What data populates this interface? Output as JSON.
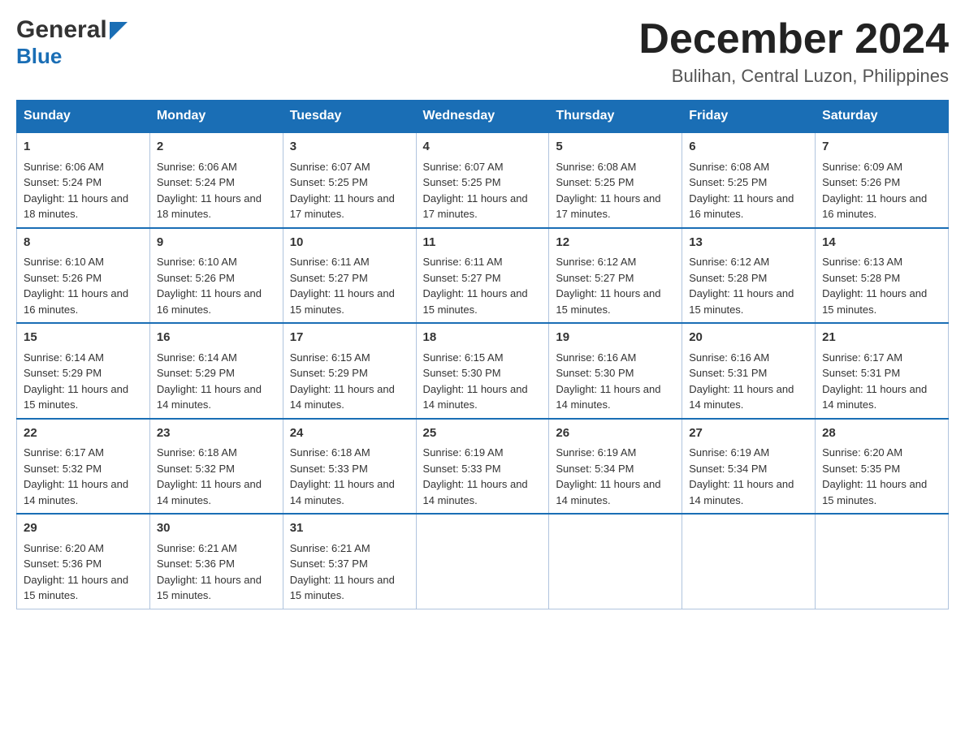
{
  "header": {
    "month_title": "December 2024",
    "location": "Bulihan, Central Luzon, Philippines",
    "logo_general": "General",
    "logo_blue": "Blue"
  },
  "days_of_week": [
    "Sunday",
    "Monday",
    "Tuesday",
    "Wednesday",
    "Thursday",
    "Friday",
    "Saturday"
  ],
  "weeks": [
    [
      {
        "day": "1",
        "sunrise": "6:06 AM",
        "sunset": "5:24 PM",
        "daylight": "11 hours and 18 minutes."
      },
      {
        "day": "2",
        "sunrise": "6:06 AM",
        "sunset": "5:24 PM",
        "daylight": "11 hours and 18 minutes."
      },
      {
        "day": "3",
        "sunrise": "6:07 AM",
        "sunset": "5:25 PM",
        "daylight": "11 hours and 17 minutes."
      },
      {
        "day": "4",
        "sunrise": "6:07 AM",
        "sunset": "5:25 PM",
        "daylight": "11 hours and 17 minutes."
      },
      {
        "day": "5",
        "sunrise": "6:08 AM",
        "sunset": "5:25 PM",
        "daylight": "11 hours and 17 minutes."
      },
      {
        "day": "6",
        "sunrise": "6:08 AM",
        "sunset": "5:25 PM",
        "daylight": "11 hours and 16 minutes."
      },
      {
        "day": "7",
        "sunrise": "6:09 AM",
        "sunset": "5:26 PM",
        "daylight": "11 hours and 16 minutes."
      }
    ],
    [
      {
        "day": "8",
        "sunrise": "6:10 AM",
        "sunset": "5:26 PM",
        "daylight": "11 hours and 16 minutes."
      },
      {
        "day": "9",
        "sunrise": "6:10 AM",
        "sunset": "5:26 PM",
        "daylight": "11 hours and 16 minutes."
      },
      {
        "day": "10",
        "sunrise": "6:11 AM",
        "sunset": "5:27 PM",
        "daylight": "11 hours and 15 minutes."
      },
      {
        "day": "11",
        "sunrise": "6:11 AM",
        "sunset": "5:27 PM",
        "daylight": "11 hours and 15 minutes."
      },
      {
        "day": "12",
        "sunrise": "6:12 AM",
        "sunset": "5:27 PM",
        "daylight": "11 hours and 15 minutes."
      },
      {
        "day": "13",
        "sunrise": "6:12 AM",
        "sunset": "5:28 PM",
        "daylight": "11 hours and 15 minutes."
      },
      {
        "day": "14",
        "sunrise": "6:13 AM",
        "sunset": "5:28 PM",
        "daylight": "11 hours and 15 minutes."
      }
    ],
    [
      {
        "day": "15",
        "sunrise": "6:14 AM",
        "sunset": "5:29 PM",
        "daylight": "11 hours and 15 minutes."
      },
      {
        "day": "16",
        "sunrise": "6:14 AM",
        "sunset": "5:29 PM",
        "daylight": "11 hours and 14 minutes."
      },
      {
        "day": "17",
        "sunrise": "6:15 AM",
        "sunset": "5:29 PM",
        "daylight": "11 hours and 14 minutes."
      },
      {
        "day": "18",
        "sunrise": "6:15 AM",
        "sunset": "5:30 PM",
        "daylight": "11 hours and 14 minutes."
      },
      {
        "day": "19",
        "sunrise": "6:16 AM",
        "sunset": "5:30 PM",
        "daylight": "11 hours and 14 minutes."
      },
      {
        "day": "20",
        "sunrise": "6:16 AM",
        "sunset": "5:31 PM",
        "daylight": "11 hours and 14 minutes."
      },
      {
        "day": "21",
        "sunrise": "6:17 AM",
        "sunset": "5:31 PM",
        "daylight": "11 hours and 14 minutes."
      }
    ],
    [
      {
        "day": "22",
        "sunrise": "6:17 AM",
        "sunset": "5:32 PM",
        "daylight": "11 hours and 14 minutes."
      },
      {
        "day": "23",
        "sunrise": "6:18 AM",
        "sunset": "5:32 PM",
        "daylight": "11 hours and 14 minutes."
      },
      {
        "day": "24",
        "sunrise": "6:18 AM",
        "sunset": "5:33 PM",
        "daylight": "11 hours and 14 minutes."
      },
      {
        "day": "25",
        "sunrise": "6:19 AM",
        "sunset": "5:33 PM",
        "daylight": "11 hours and 14 minutes."
      },
      {
        "day": "26",
        "sunrise": "6:19 AM",
        "sunset": "5:34 PM",
        "daylight": "11 hours and 14 minutes."
      },
      {
        "day": "27",
        "sunrise": "6:19 AM",
        "sunset": "5:34 PM",
        "daylight": "11 hours and 14 minutes."
      },
      {
        "day": "28",
        "sunrise": "6:20 AM",
        "sunset": "5:35 PM",
        "daylight": "11 hours and 15 minutes."
      }
    ],
    [
      {
        "day": "29",
        "sunrise": "6:20 AM",
        "sunset": "5:36 PM",
        "daylight": "11 hours and 15 minutes."
      },
      {
        "day": "30",
        "sunrise": "6:21 AM",
        "sunset": "5:36 PM",
        "daylight": "11 hours and 15 minutes."
      },
      {
        "day": "31",
        "sunrise": "6:21 AM",
        "sunset": "5:37 PM",
        "daylight": "11 hours and 15 minutes."
      },
      null,
      null,
      null,
      null
    ]
  ],
  "colors": {
    "header_bg": "#1a6eb5",
    "header_text": "#ffffff",
    "border": "#1a6eb5",
    "cell_border": "#b0c4de"
  }
}
